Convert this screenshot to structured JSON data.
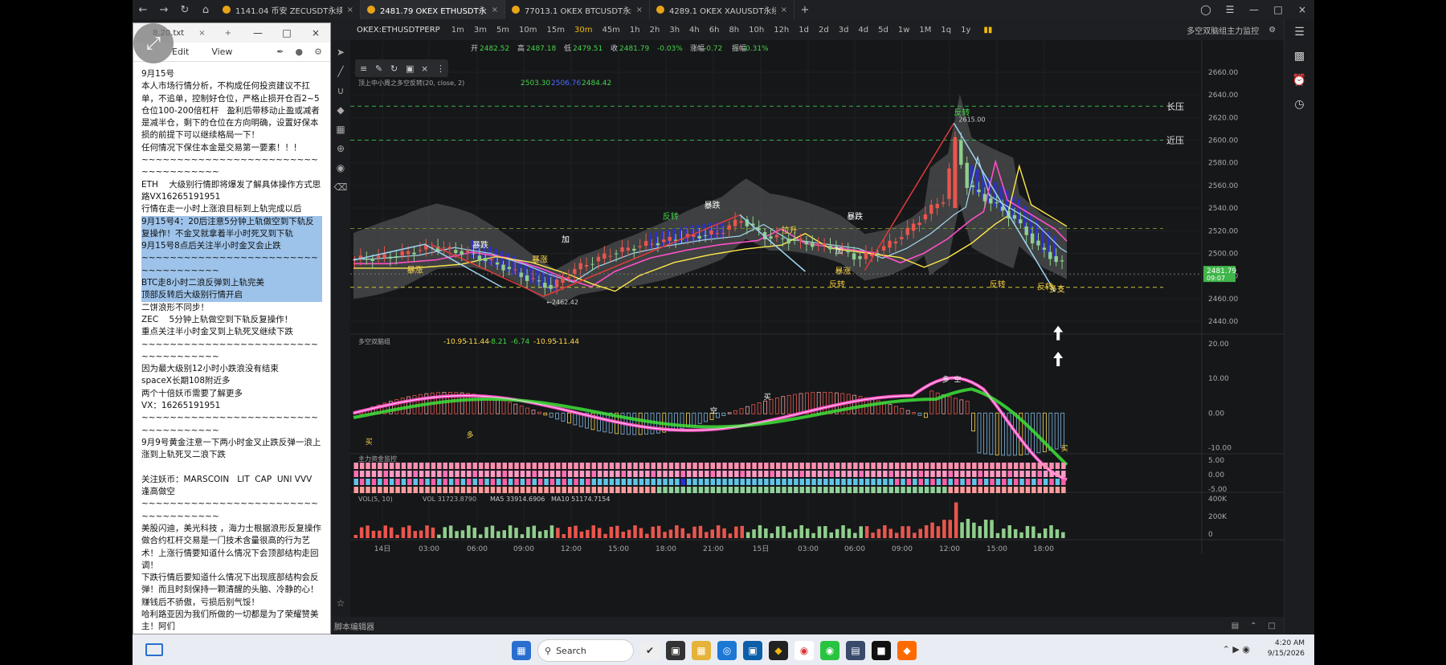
{
  "browser": {
    "tabs": [
      {
        "title": "1141.04 币安 ZECUSDT永续",
        "active": false
      },
      {
        "title": "2481.79 OKEX ETHUSDT永续",
        "active": true
      },
      {
        "title": "77013.1 OKEX BTCUSDT永续",
        "active": false
      },
      {
        "title": "4289.1 OKEX XAUUSDT永续",
        "active": false
      }
    ],
    "new_tab": "+"
  },
  "notepad": {
    "title": "8.20.txt",
    "menu": {
      "edit": "Edit",
      "view": "View"
    },
    "lines": [
      {
        "text": "9月15号",
        "hl": false
      },
      {
        "text": "本人市场行情分析，不构成任何投资建议不扛单，不追单，控制好仓位，严格止损开仓百2~5仓位100-200倍杠杆   盈利后带移动止盈或减者是减半仓，剩下的仓位在方向明确，设置好保本损的前提下可以继续格局一下！",
        "hl": false
      },
      {
        "text": "任何情况下保住本金是交易第一要素！！！",
        "hl": false
      },
      {
        "text": "~~~~~~~~~~~~~~~~~~~~~~~~~~~~~~~~~~~~",
        "hl": false
      },
      {
        "text": "ETH    大级别行情即将爆发了解具体操作方式思路VX16265191951",
        "hl": false
      },
      {
        "text": "行情在走一小时上涨浪目标到上轨完成以后",
        "hl": false
      },
      {
        "text": "9月15号4：20后注意5分钟上轨做空到下轨反复操作！不金叉就拿着半小时死叉到下轨",
        "hl": true
      },
      {
        "text": "9月15号8点后关注半小时金叉会止跌",
        "hl": true
      },
      {
        "text": "~~~~~~~~~~~~~~~~~~~~~~~~~~~~~~~~~~~~",
        "hl": true
      },
      {
        "text": "BTC走8小时二浪反弹到上轨完美",
        "hl": true
      },
      {
        "text": "顶部反转后大级别行情开启",
        "hl": true
      },
      {
        "text": "二饼浪形不同步！",
        "hl": false
      },
      {
        "text": "ZEC    5分钟上轨做空到下轨反复操作！",
        "hl": false
      },
      {
        "text": "重点关注半小时金叉到上轨死叉继续下跌",
        "hl": false
      },
      {
        "text": "~~~~~~~~~~~~~~~~~~~~~~~~~~~~~~~~~~~~",
        "hl": false
      },
      {
        "text": "因为最大级别12小时小跌浪没有结束",
        "hl": false
      },
      {
        "text": "spaceX长期108附近多",
        "hl": false
      },
      {
        "text": "两个十倍妖币需要了解更多",
        "hl": false
      },
      {
        "text": "VX：16265191951",
        "hl": false
      },
      {
        "text": "~~~~~~~~~~~~~~~~~~~~~~~~~~~~~~~~~~~~",
        "hl": false
      },
      {
        "text": "9月9号黄金注意一下两小时金叉止跌反弹一浪上涨到上轨死叉二浪下跌",
        "hl": false
      },
      {
        "text": " ",
        "hl": false
      },
      {
        "text": "关注妖币：MARSCOIN   LIT  CAP  UNI VVV 逢高做空",
        "hl": false
      },
      {
        "text": "~~~~~~~~~~~~~~~~~~~~~~~~~~~~~~~~~~~~",
        "hl": false
      },
      {
        "text": "美股闪迪，美光科技 ，海力士根据浪形反复操作",
        "hl": false
      },
      {
        "text": "做合约杠杆交易是一门技术含量很高的行为艺术！上涨行情要知道什么情况下会顶部结构走回调！",
        "hl": false
      },
      {
        "text": "下跌行情后要知道什么情况下出现底部结构会反弹！而且时刻保持一颗清醒的头脑、冷静的心！赚钱后不骄傲，亏损后别气馁！",
        "hl": false
      },
      {
        "text": "哈利路亚因为我们所做的一切都是为了荣耀赞美主！阿们",
        "hl": false
      }
    ]
  },
  "app": {
    "symbol": "OKEX:ETHUSDTPERP",
    "timeframes": [
      "1m",
      "3m",
      "5m",
      "10m",
      "15m",
      "30m",
      "45m",
      "1h",
      "2h",
      "3h",
      "4h",
      "6h",
      "8h",
      "10h",
      "12h",
      "1d",
      "2d",
      "3d",
      "4d",
      "5d",
      "1w",
      "1M",
      "1q",
      "1y"
    ],
    "active_timeframe": "30m",
    "indicator_label": "多空双脑组主力监控",
    "ohlc": {
      "open_label": "开",
      "open": "2482.52",
      "high_label": "高",
      "high": "2487.18",
      "low_label": "低",
      "low": "2479.51",
      "close_label": "收",
      "close": "2481.79",
      "change": "-0.03%",
      "chg_label": "涨幅",
      "chg_val": "-0.72",
      "amp_label": "振幅",
      "amp_val": "0.31%"
    },
    "main_indicator": {
      "name": "顶上中小周之多空反转(20, close, 2)",
      "v1": "2503.30",
      "v2": "2506.76",
      "v3": "2484.42"
    },
    "macd_indicator": {
      "name": "多空双脑组",
      "vals": [
        "-10.95",
        "-11.44",
        "-8.21",
        "-6.74",
        "-10.95",
        "-11.44"
      ]
    },
    "flow_indicator": {
      "name": "主力资金监控"
    },
    "vol_indicator": {
      "name": "VOL(5, 10)",
      "vol": "VOL 31723.8790",
      "ma5": "MA5 33914.6906",
      "ma10": "MA10 51174.7154"
    },
    "price_axis": [
      "2660.00",
      "2640.00",
      "2620.00",
      "2600.00",
      "2580.00",
      "2560.00",
      "2540.00",
      "2520.00",
      "2500.00",
      "2480.00",
      "2460.00",
      "2440.00"
    ],
    "macd_axis": [
      "20.00",
      "10.00",
      "0.00",
      "-10.00"
    ],
    "flow_axis": [
      "5.00",
      "0.00",
      "-5.00"
    ],
    "vol_axis": [
      "400K",
      "200K",
      "0"
    ],
    "time_axis": [
      "14日",
      "03:00",
      "06:00",
      "09:00",
      "12:00",
      "15:00",
      "18:00",
      "21:00",
      "15日",
      "03:00",
      "06:00",
      "09:00",
      "12:00",
      "15:00",
      "18:00"
    ],
    "current_price": "2481.79",
    "countdown": "09:07",
    "high_mark": "2615.00",
    "low_mark": "2462.42",
    "annotations": {
      "long_resist": "长压",
      "near_resist": "近压",
      "reversal": "反转",
      "crash": "暴跌",
      "surge": "暴涨",
      "add": "加",
      "pull": "拉升",
      "support": "多支",
      "buy": "买",
      "sell": "卖",
      "long": "多",
      "short": "空"
    },
    "bottom_status": "脚本编辑器"
  },
  "taskbar": {
    "search": "Search",
    "time": "4:20 AM",
    "date": "9/15/2026"
  },
  "colors": {
    "up": "#e8564d",
    "down": "#8fce8c",
    "band": "#555658",
    "pink": "#ff4fc8",
    "green": "#3ee03a",
    "yellow": "#ffe94a",
    "blue": "#2a2fd8",
    "accent": "#f0b90b"
  }
}
